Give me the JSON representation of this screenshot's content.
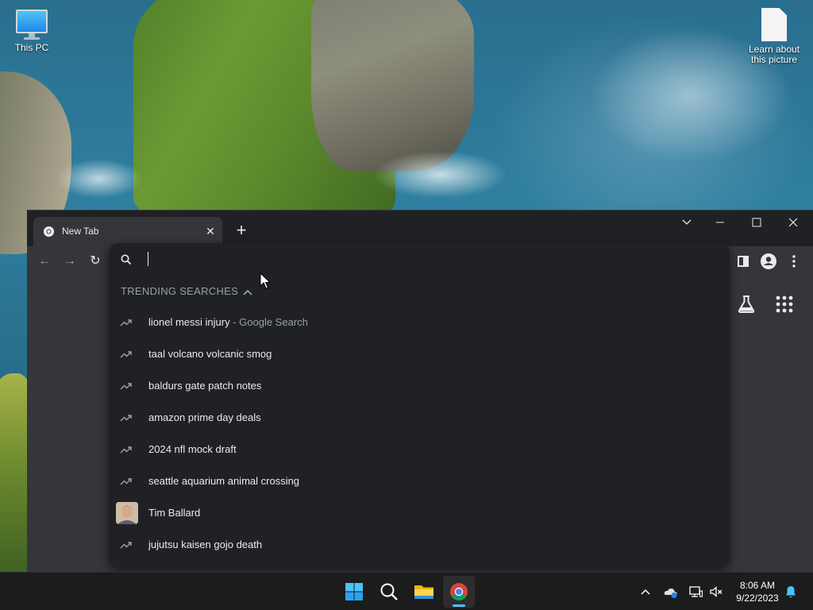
{
  "desktop": {
    "icons": [
      {
        "label": "This PC"
      },
      {
        "label_line1": "Learn about",
        "label_line2": "this picture"
      }
    ]
  },
  "browser": {
    "tab": {
      "title": "New Tab",
      "close_label": "✕"
    },
    "new_tab_label": "+",
    "window_controls": {
      "tab_search": "⌄",
      "minimize": "—",
      "maximize": "☐",
      "close": "✕"
    },
    "nav": {
      "back": "←",
      "forward": "→",
      "reload": "↻"
    }
  },
  "omnibox": {
    "value": "",
    "placeholder": "",
    "section_header": "TRENDING SEARCHES",
    "suggestions": [
      {
        "type": "trend",
        "text": "lionel messi injury",
        "desc": " - Google Search"
      },
      {
        "type": "trend",
        "text": "taal volcano volcanic smog"
      },
      {
        "type": "trend",
        "text": "baldurs gate patch notes"
      },
      {
        "type": "trend",
        "text": "amazon prime day deals"
      },
      {
        "type": "trend",
        "text": "2024 nfl mock draft"
      },
      {
        "type": "trend",
        "text": "seattle aquarium animal crossing"
      },
      {
        "type": "entity",
        "text": "Tim Ballard"
      },
      {
        "type": "trend",
        "text": "jujutsu kaisen gojo death"
      }
    ]
  },
  "taskbar": {
    "clock": {
      "time": "8:06 AM",
      "date": "9/22/2023"
    }
  },
  "colors": {
    "popup_bg": "#202124",
    "toolbar_bg": "#35363a",
    "text_primary": "#e8eaed",
    "text_secondary": "#9aa0a6",
    "taskbar_bg": "#1c1c1c",
    "accent": "#4cc2ff"
  }
}
